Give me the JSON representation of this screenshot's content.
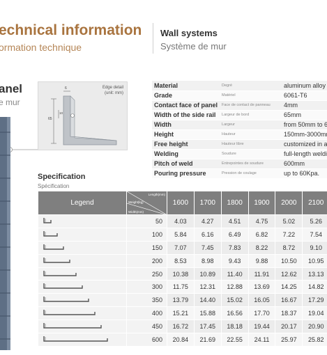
{
  "header": {
    "title": "echnical information",
    "subtitle": "ormation technique",
    "right_title": "Wall systems",
    "right_subtitle": "Système de mur"
  },
  "section": {
    "title": "anel",
    "subtitle": "e mur"
  },
  "edge_detail": {
    "label_line1": "Edge detail",
    "label_line2": "(unit: mm)",
    "dim_top": "6",
    "dim_left": "65",
    "dim_small": "10"
  },
  "specs": [
    {
      "key": "Material",
      "fr": "Degré",
      "value": "aluminum alloy"
    },
    {
      "key": "Grade",
      "fr": "Matériel",
      "value": "6061-T6"
    },
    {
      "key": "Contact face of panel",
      "fr": "Face de contact de panneau",
      "value": "4mm"
    },
    {
      "key": "Width of the side rail",
      "fr": "Largeur de bord",
      "value": "65mm"
    },
    {
      "key": "Width",
      "fr": "Largeur",
      "value": "from 50mm to 6"
    },
    {
      "key": "Height",
      "fr": "Hauteur",
      "value": "150mm-3000mm"
    },
    {
      "key": "Free height",
      "fr": "Hauteur libre",
      "value": "customized in a"
    },
    {
      "key": "Welding",
      "fr": "Soudure",
      "value": "full-length weldi"
    },
    {
      "key": "Pitch of weld",
      "fr": "Entrepointes de soudure",
      "value": "600mm"
    },
    {
      "key": "Pouring pressure",
      "fr": "Pression de coulage",
      "value": "up to 60Kpa."
    }
  ],
  "specification": {
    "title": "Specification",
    "subtitle": "Spécification",
    "legend_label": "Legend",
    "diag_length": "Length(mm)",
    "diag_weight": "Weight(kg)",
    "diag_width": "Width(mm)",
    "lengths": [
      "1600",
      "1700",
      "1800",
      "1900",
      "2000",
      "2100",
      "2"
    ],
    "rows": [
      {
        "width": "50",
        "values": [
          "4.03",
          "4.27",
          "4.51",
          "4.75",
          "5.02",
          "5.26",
          "5"
        ]
      },
      {
        "width": "100",
        "values": [
          "5.84",
          "6.16",
          "6.49",
          "6.82",
          "7.22",
          "7.54",
          "7"
        ]
      },
      {
        "width": "150",
        "values": [
          "7.07",
          "7.45",
          "7.83",
          "8.22",
          "8.72",
          "9.10",
          "9"
        ]
      },
      {
        "width": "200",
        "values": [
          "8.53",
          "8.98",
          "9.43",
          "9.88",
          "10.50",
          "10.95",
          "1"
        ]
      },
      {
        "width": "250",
        "values": [
          "10.38",
          "10.89",
          "11.40",
          "11.91",
          "12.62",
          "13.13",
          "1"
        ]
      },
      {
        "width": "300",
        "values": [
          "11.75",
          "12.31",
          "12.88",
          "13.69",
          "14.25",
          "14.82",
          "1"
        ]
      },
      {
        "width": "350",
        "values": [
          "13.79",
          "14.40",
          "15.02",
          "16.05",
          "16.67",
          "17.29",
          "1"
        ]
      },
      {
        "width": "400",
        "values": [
          "15.21",
          "15.88",
          "16.56",
          "17.70",
          "18.37",
          "19.04",
          "2"
        ]
      },
      {
        "width": "450",
        "values": [
          "16.72",
          "17.45",
          "18.18",
          "19.44",
          "20.17",
          "20.90",
          "2"
        ]
      },
      {
        "width": "600",
        "values": [
          "20.84",
          "21.69",
          "22.55",
          "24.11",
          "25.97",
          "25.82",
          "2"
        ]
      }
    ]
  }
}
